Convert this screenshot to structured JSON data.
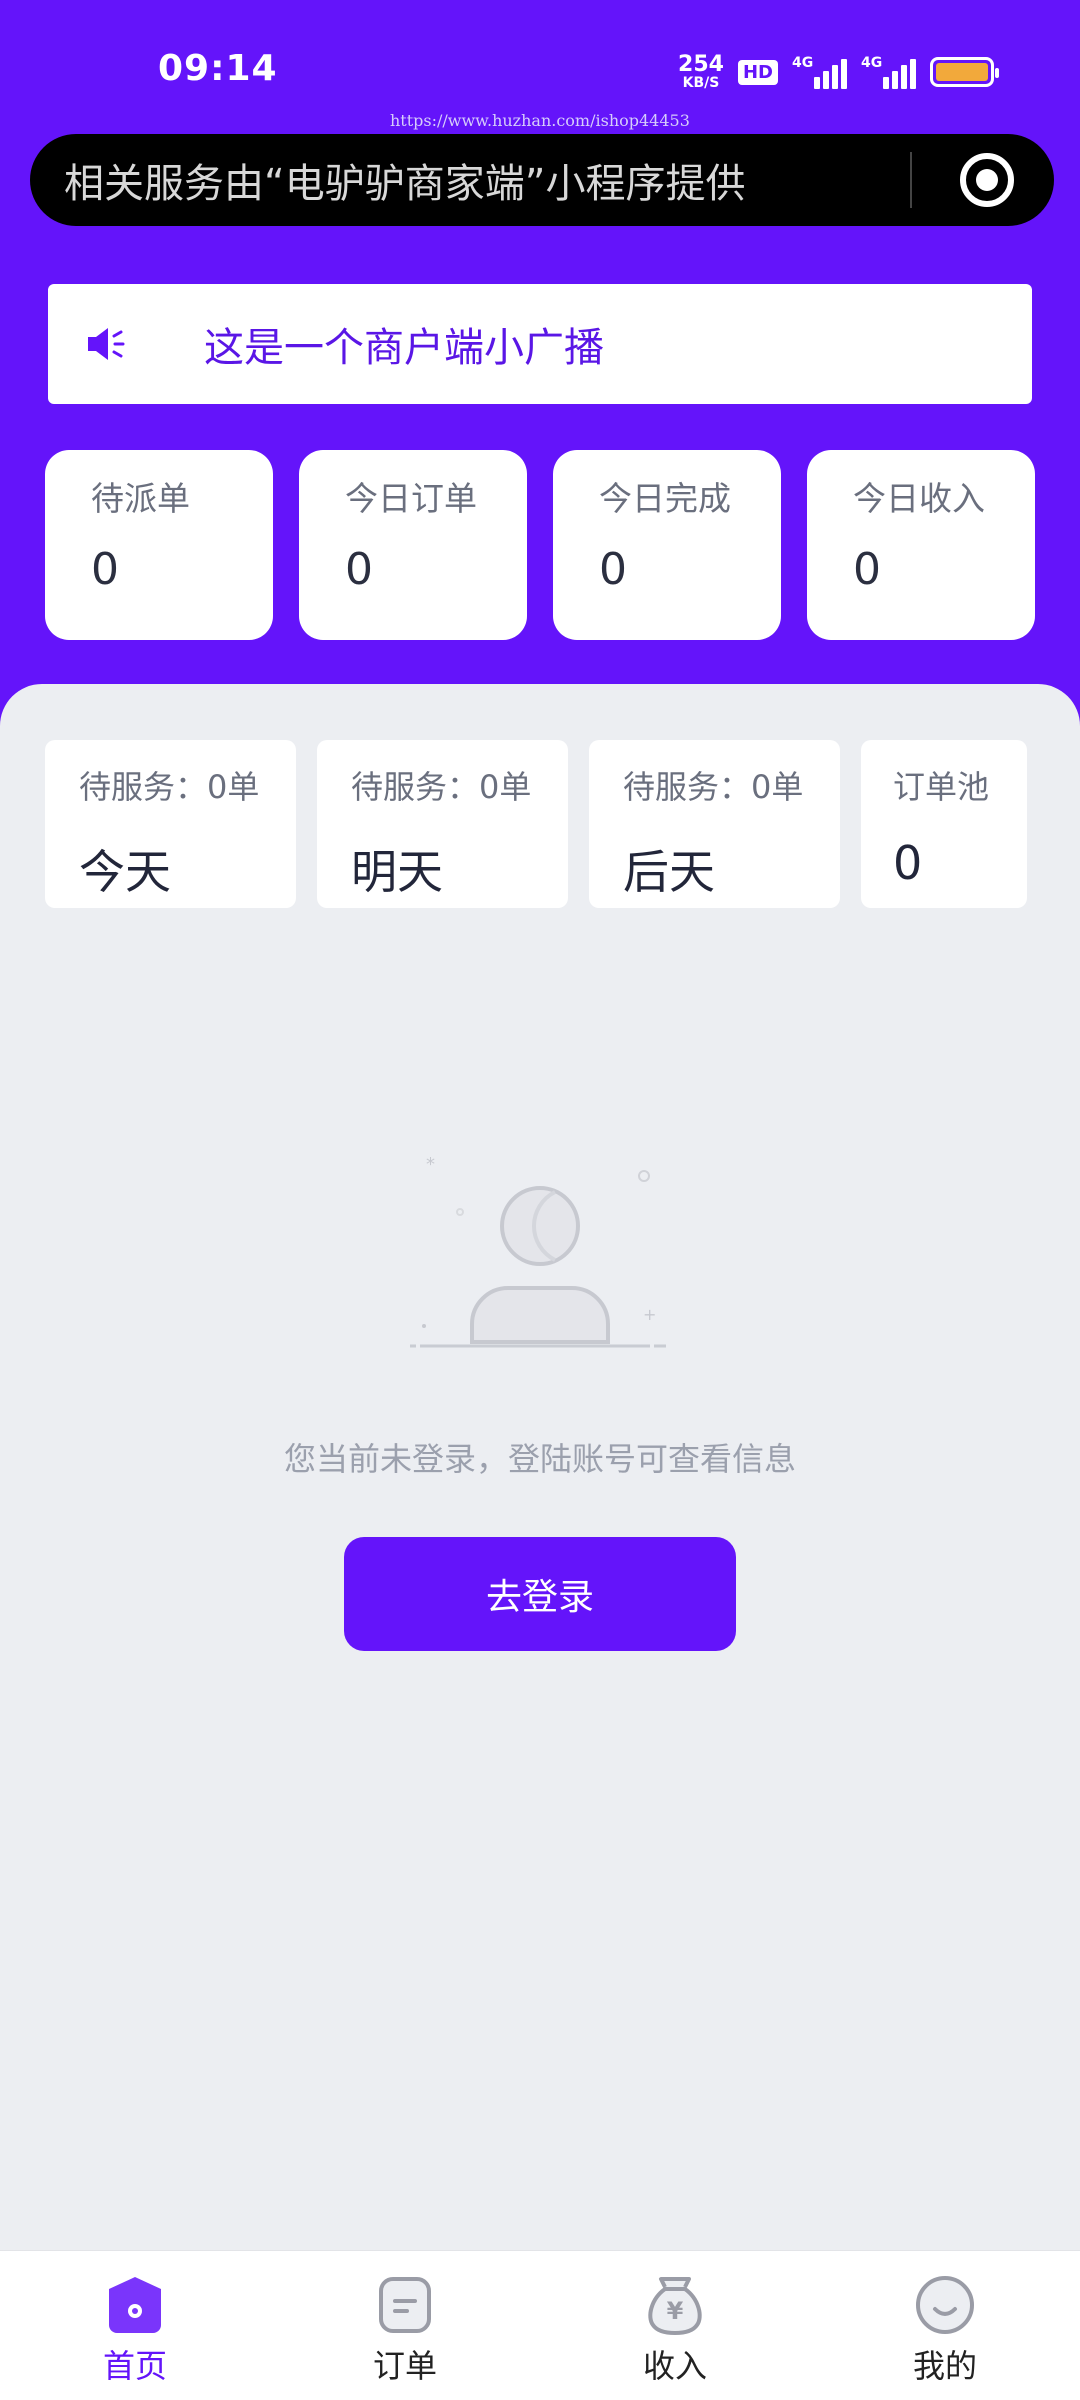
{
  "status_bar": {
    "time": "09:14",
    "net_speed_value": "254",
    "net_speed_unit": "KB/S",
    "hd_label": "HD",
    "signal1_label": "4G",
    "signal2_label": "4G",
    "battery_level": 1.0
  },
  "watermark": "https://www.huzhan.com/ishop44453",
  "mini_program_notice": {
    "text": "相关服务由“电驴驴商家端”小程序提供"
  },
  "broadcast": {
    "text": "这是一个商户端小广播"
  },
  "stats": [
    {
      "label": "待派单",
      "value": "0"
    },
    {
      "label": "今日订单",
      "value": "0"
    },
    {
      "label": "今日完成",
      "value": "0"
    },
    {
      "label": "今日收入",
      "value": "0"
    }
  ],
  "schedule": [
    {
      "top": "待服务：0单",
      "bottom": "今天"
    },
    {
      "top": "待服务：0单",
      "bottom": "明天"
    },
    {
      "top": "待服务：0单",
      "bottom": "后天"
    },
    {
      "top": "订单池",
      "bottom": "0"
    }
  ],
  "empty_state": {
    "message": "您当前未登录，登陆账号可查看信息",
    "button_label": "去登录"
  },
  "tabbar": [
    {
      "label": "首页",
      "icon": "home-icon",
      "active": true
    },
    {
      "label": "订单",
      "icon": "order-icon",
      "active": false
    },
    {
      "label": "收入",
      "icon": "money-bag-icon",
      "active": false
    },
    {
      "label": "我的",
      "icon": "profile-icon",
      "active": false
    }
  ],
  "colors": {
    "brand": "#6414fa",
    "battery": "#f2a93b",
    "page_bg": "#eceef2"
  }
}
